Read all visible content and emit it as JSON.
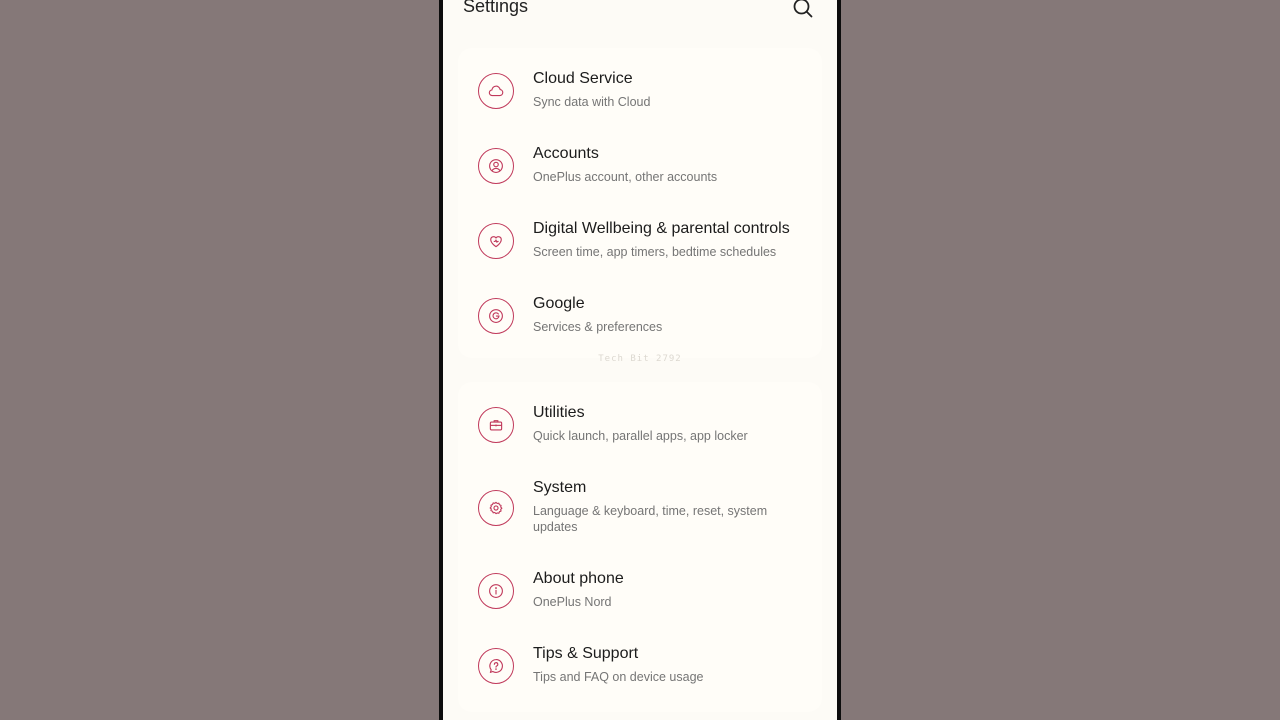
{
  "header": {
    "title": "Settings",
    "search_icon": "search-icon"
  },
  "colors": {
    "accent": "#c0395b",
    "screen_bg": "#fdfbf6",
    "backdrop": "#857878"
  },
  "watermark": "Tech Bit 2792",
  "group1": [
    {
      "label": "Cloud Service",
      "subtitle": "Sync data with Cloud",
      "icon": "cloud-icon"
    },
    {
      "label": "Accounts",
      "subtitle": "OnePlus account, other accounts",
      "icon": "account-icon"
    },
    {
      "label": "Digital Wellbeing & parental controls",
      "subtitle": "Screen time, app timers, bedtime schedules",
      "icon": "heart-icon"
    },
    {
      "label": "Google",
      "subtitle": "Services & preferences",
      "icon": "google-icon"
    }
  ],
  "group2": [
    {
      "label": "Utilities",
      "subtitle": "Quick launch, parallel apps, app locker",
      "icon": "toolbox-icon"
    },
    {
      "label": "System",
      "subtitle": "Language & keyboard, time, reset, system updates",
      "icon": "gear-icon"
    },
    {
      "label": "About phone",
      "subtitle": "OnePlus Nord",
      "icon": "info-icon"
    },
    {
      "label": "Tips & Support",
      "subtitle": "Tips and FAQ on device usage",
      "icon": "help-icon"
    }
  ]
}
